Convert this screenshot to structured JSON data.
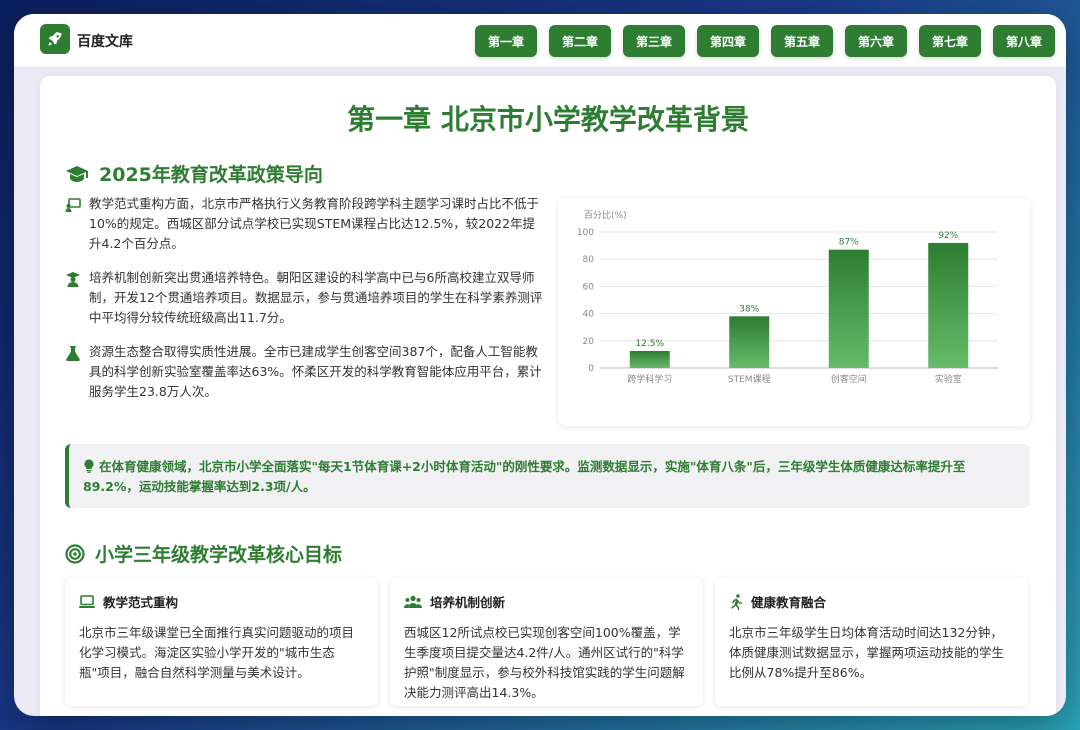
{
  "app": {
    "logo_text": "百度文库"
  },
  "nav": {
    "chapters": [
      "第一章",
      "第二章",
      "第三章",
      "第四章",
      "第五章",
      "第六章",
      "第七章",
      "第八章"
    ]
  },
  "page": {
    "title": "第一章 北京市小学教学改革背景"
  },
  "section1": {
    "title": "2025年教育改革政策导向",
    "bullets": [
      {
        "icon": "teacher-board-icon",
        "text": "教学范式重构方面，北京市严格执行义务教育阶段跨学科主题学习课时占比不低于10%的规定。西城区部分试点学校已实现STEM课程占比达12.5%，较2022年提升4.2个百分点。"
      },
      {
        "icon": "graduate-icon",
        "text": "培养机制创新突出贯通培养特色。朝阳区建设的科学高中已与6所高校建立双导师制，开发12个贯通培养项目。数据显示，参与贯通培养项目的学生在科学素养测评中平均得分较传统班级高出11.7分。"
      },
      {
        "icon": "flask-icon",
        "text": "资源生态整合取得实质性进展。全市已建成学生创客空间387个，配备人工智能教具的科学创新实验室覆盖率达63%。怀柔区开发的科学教育智能体应用平台，累计服务学生23.8万人次。"
      }
    ]
  },
  "chart_data": {
    "type": "bar",
    "categories": [
      "跨学科学习",
      "STEM课程",
      "创客空间",
      "实验室"
    ],
    "values": [
      12.5,
      38,
      87,
      92
    ],
    "value_labels": [
      "12.5%",
      "38%",
      "87%",
      "92%"
    ],
    "ylabel": "百分比(%)",
    "ylim": [
      0,
      100
    ],
    "yticks": [
      0,
      20,
      40,
      60,
      80,
      100
    ],
    "grid": true,
    "colors": {
      "bar_top": "#2e7d32",
      "bar_bottom": "#66bb6a",
      "label": "#2e7d32"
    }
  },
  "highlight": {
    "text": "在体育健康领域，北京市小学全面落实\"每天1节体育课+2小时体育活动\"的刚性要求。监测数据显示，实施\"体育八条\"后，三年级学生体质健康达标率提升至89.2%，运动技能掌握率达到2.3项/人。"
  },
  "section2": {
    "title": "小学三年级教学改革核心目标",
    "cards": [
      {
        "icon": "laptop-icon",
        "title": "教学范式重构",
        "text": "北京市三年级课堂已全面推行真实问题驱动的项目化学习模式。海淀区实验小学开发的\"城市生态瓶\"项目，融合自然科学测量与美术设计。"
      },
      {
        "icon": "users-icon",
        "title": "培养机制创新",
        "text": "西城区12所试点校已实现创客空间100%覆盖，学生季度项目提交量达4.2件/人。通州区试行的\"科学护照\"制度显示，参与校外科技馆实践的学生问题解决能力测评高出14.3%。"
      },
      {
        "icon": "running-icon",
        "title": "健康教育融合",
        "text": "北京市三年级学生日均体育活动时间达132分钟，体质健康测试数据显示，掌握两项运动技能的学生比例从78%提升至86%。"
      }
    ]
  },
  "colors": {
    "primary": "#2e7d32",
    "window_bg": "#eceaf6"
  }
}
